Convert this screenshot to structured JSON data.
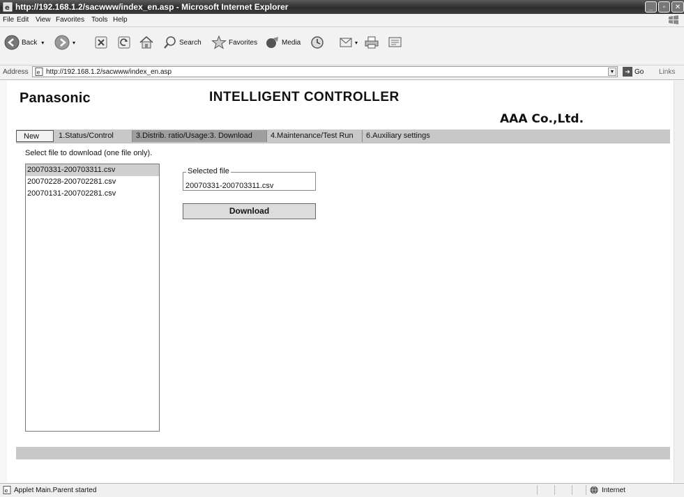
{
  "window": {
    "title": "http://192.168.1.2/sacwww/index_en.asp - Microsoft Internet Explorer"
  },
  "menu": [
    "File",
    "Edit",
    "View",
    "Favorites",
    "Tools",
    "Help"
  ],
  "toolbar": {
    "back": "Back",
    "search": "Search",
    "favorites": "Favorites",
    "media": "Media"
  },
  "address": {
    "label": "Address",
    "url": "http://192.168.1.2/sacwww/index_en.asp",
    "go": "Go",
    "links": "Links"
  },
  "header": {
    "brand": "Panasonic",
    "title": "INTELLIGENT CONTROLLER",
    "company": "AAA Co.,Ltd."
  },
  "tabs": [
    "New",
    "1.Status/Control",
    "3.Distrib. ratio/Usage:3. Download",
    "4.Maintenance/Test Run",
    "6.Auxiliary settings"
  ],
  "instruction": "Select file to download (one file only).",
  "files": [
    "20070331-200703311.csv",
    "20070228-200702281.csv",
    "20070131-200702281.csv"
  ],
  "selected": {
    "legend": "Selected file",
    "value": "20070331-200703311.csv"
  },
  "download_label": "Download",
  "status": {
    "message": "Applet Main.Parent started",
    "zone": "Internet"
  }
}
